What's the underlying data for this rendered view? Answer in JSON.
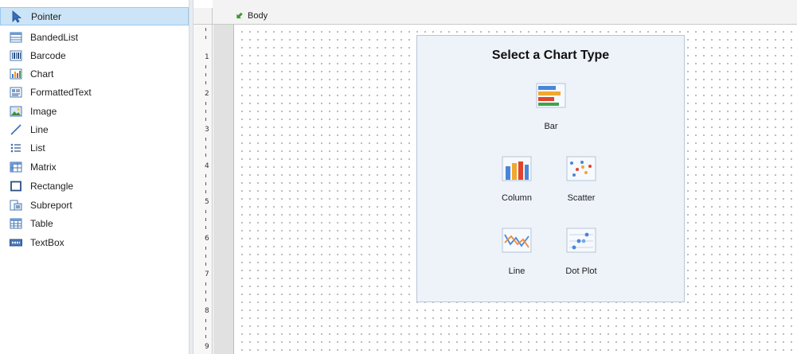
{
  "toolbox": {
    "items": [
      {
        "label": "Pointer",
        "icon": "pointer-icon",
        "selected": true
      },
      {
        "label": "BandedList",
        "icon": "banded-list-icon"
      },
      {
        "label": "Barcode",
        "icon": "barcode-icon"
      },
      {
        "label": "Chart",
        "icon": "chart-icon"
      },
      {
        "label": "FormattedText",
        "icon": "formatted-text-icon"
      },
      {
        "label": "Image",
        "icon": "image-icon"
      },
      {
        "label": "Line",
        "icon": "line-icon"
      },
      {
        "label": "List",
        "icon": "list-icon"
      },
      {
        "label": "Matrix",
        "icon": "matrix-icon"
      },
      {
        "label": "Rectangle",
        "icon": "rectangle-icon"
      },
      {
        "label": "Subreport",
        "icon": "subreport-icon"
      },
      {
        "label": "Table",
        "icon": "table-icon"
      },
      {
        "label": "TextBox",
        "icon": "textbox-icon"
      }
    ]
  },
  "ruler": {
    "numbers": [
      "1",
      "2",
      "3",
      "4",
      "5",
      "6",
      "7",
      "8",
      "9"
    ]
  },
  "section": {
    "label": "Body",
    "icon": "section-arrow-icon"
  },
  "chart_chooser": {
    "title": "Select a Chart Type",
    "options": [
      {
        "label": "Bar",
        "icon": "bar-chart-icon"
      },
      {
        "label": "Column",
        "icon": "column-chart-icon"
      },
      {
        "label": "Scatter",
        "icon": "scatter-chart-icon"
      },
      {
        "label": "Line",
        "icon": "line-chart-icon"
      },
      {
        "label": "Dot Plot",
        "icon": "dot-plot-icon"
      }
    ]
  },
  "colors": {
    "selection": "#cce4f7",
    "panel_background": "#eef3fa",
    "section_arrow": "#3c9a2f"
  }
}
